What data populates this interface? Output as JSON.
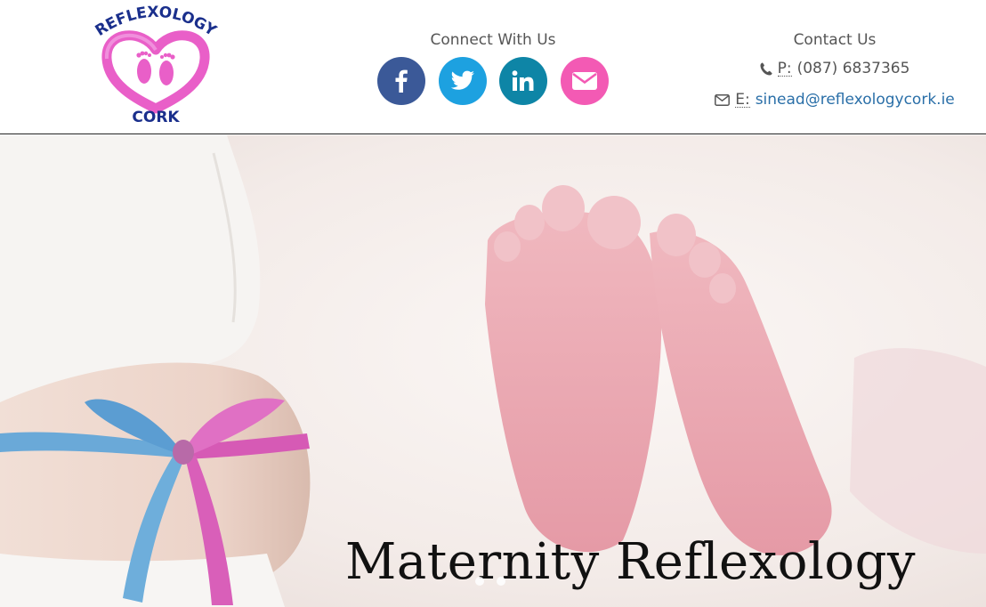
{
  "logo": {
    "top_text": "REFLEXOLOGY",
    "bottom_text": "CORK",
    "colors": {
      "text": "#1a2f8c",
      "heart": "#e95fc8",
      "feet": "#e95fc8"
    }
  },
  "connect": {
    "title": "Connect With Us",
    "socials": [
      {
        "icon": "facebook-icon",
        "color": "#3b5998"
      },
      {
        "icon": "twitter-icon",
        "color": "#1da1e0"
      },
      {
        "icon": "linkedin-icon",
        "color": "#0e85a6"
      },
      {
        "icon": "envelope-icon",
        "color": "#f35ab4"
      }
    ]
  },
  "contact": {
    "title": "Contact Us",
    "phone_abbr": "P:",
    "phone": "(087) 6837365",
    "email_abbr": "E:",
    "email": "sinead@reflexologycork.ie"
  },
  "hero": {
    "caption": "Maternity Reflexology"
  }
}
